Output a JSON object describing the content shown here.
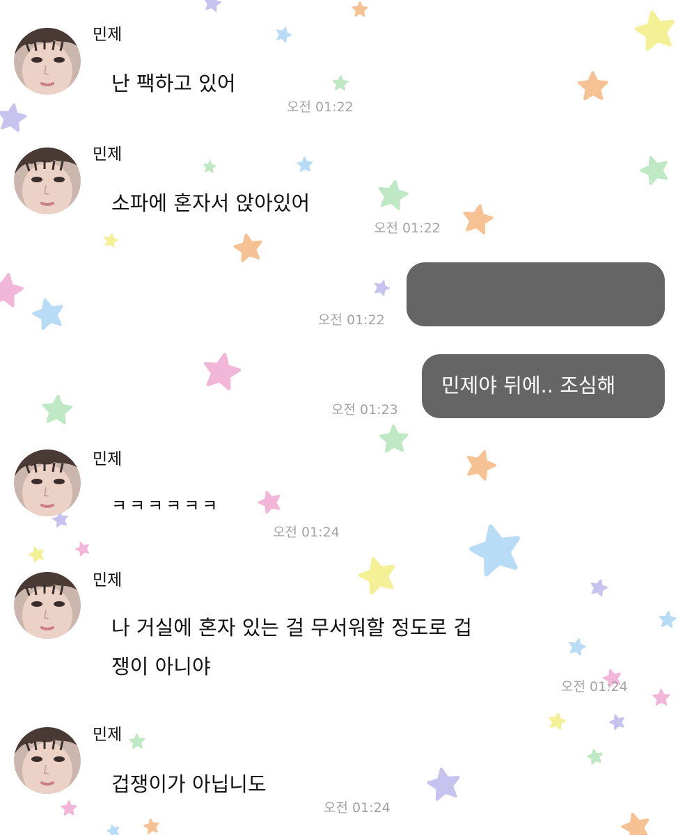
{
  "chat": {
    "sender_name": "민제",
    "messages": [
      {
        "side": "left",
        "sender": "민제",
        "text": "난 팩하고 있어",
        "time": "오전 01:22"
      },
      {
        "side": "left",
        "sender": "민제",
        "text": "소파에 혼자서 앉아있어",
        "time": "오전 01:22"
      },
      {
        "side": "right",
        "text": "",
        "time": "오전 01:22"
      },
      {
        "side": "right",
        "text": "민제야 뒤에.. 조심해",
        "time": "오전 01:23"
      },
      {
        "side": "left",
        "sender": "민제",
        "text": "ㅋㅋㅋㅋㅋㅋ",
        "time": "오전 01:24"
      },
      {
        "side": "left",
        "sender": "민제",
        "text_line1": "나 거실에 혼자 있는 걸 무서워할 정도로 겁",
        "text_line2": "쟁이 아니야",
        "time": "오전 01:24"
      },
      {
        "side": "left",
        "sender": "민제",
        "text": "겁쟁이가 아닙니도",
        "time": "오전 01:24"
      }
    ]
  },
  "colors": {
    "bubble_bg": "#656565",
    "bubble_text": "#ffffff",
    "timestamp": "#a3a3a3",
    "star_pink": "#f2b6d9",
    "star_blue": "#b9dcf6",
    "star_green": "#bfe8c4",
    "star_yellow": "#f4f096",
    "star_orange": "#f6c294",
    "star_purple": "#c7c3ef"
  }
}
